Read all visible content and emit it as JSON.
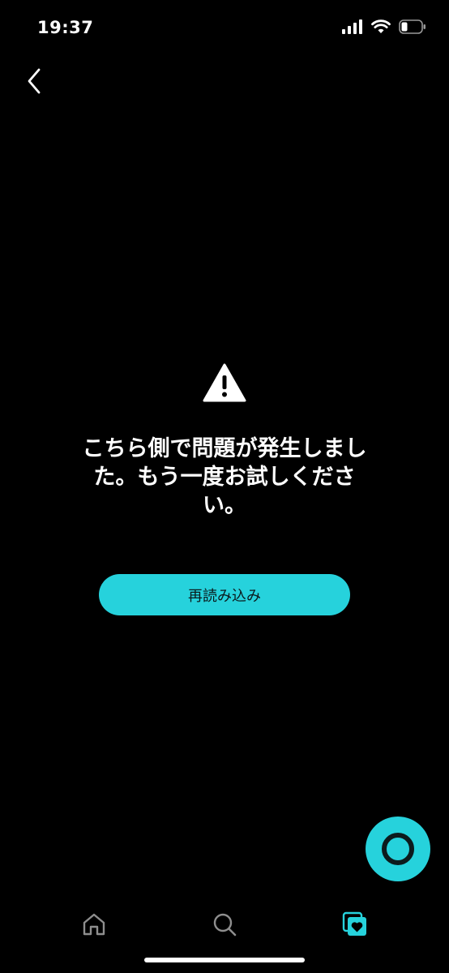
{
  "status_bar": {
    "time": "19:37",
    "icons": [
      "cellular-signal-icon",
      "wifi-icon",
      "battery-icon"
    ]
  },
  "nav": {
    "back_icon": "chevron-left-icon"
  },
  "error": {
    "icon": "warning-triangle-icon",
    "message": "こちら側で問題が発生しました。もう一度お試しください。"
  },
  "reload_button": {
    "label": "再読み込み"
  },
  "alexa_button": {
    "icon": "alexa-ring-icon"
  },
  "bottom_nav": {
    "items": [
      {
        "icon": "home-icon",
        "active": false
      },
      {
        "icon": "search-icon",
        "active": false
      },
      {
        "icon": "library-heart-icon",
        "active": true
      }
    ]
  },
  "colors": {
    "background": "#000000",
    "accent": "#26d2dc",
    "text": "#ffffff",
    "inactive_icon": "#8e8e8e"
  }
}
